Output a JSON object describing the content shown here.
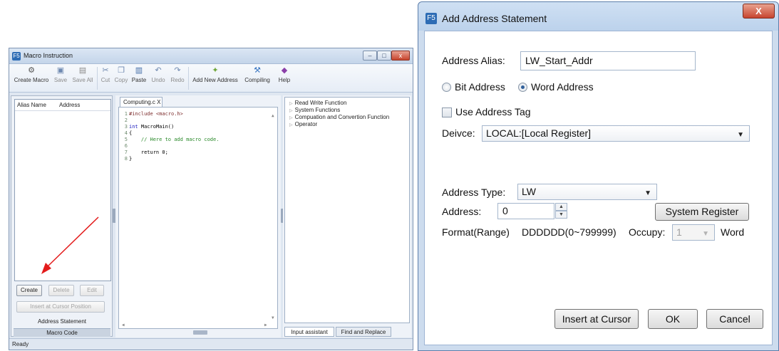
{
  "macro_window": {
    "title": "Macro Instruction",
    "ribbon": [
      {
        "label": "Create Macro",
        "icon": "create-macro-icon",
        "glyph": "⚙"
      },
      {
        "label": "Save",
        "icon": "save-icon",
        "glyph": "▣"
      },
      {
        "label": "Save All",
        "icon": "save-all-icon",
        "glyph": "▤"
      },
      {
        "label": "Cut",
        "icon": "cut-icon",
        "glyph": "✂"
      },
      {
        "label": "Copy",
        "icon": "copy-icon",
        "glyph": "❐"
      },
      {
        "label": "Paste",
        "icon": "paste-icon",
        "glyph": "▥"
      },
      {
        "label": "Undo",
        "icon": "undo-icon",
        "glyph": "↶"
      },
      {
        "label": "Redo",
        "icon": "redo-icon",
        "glyph": "↷"
      },
      {
        "label": "Add New Address",
        "icon": "add-address-icon",
        "glyph": "✦"
      },
      {
        "label": "Compiling",
        "icon": "compiling-icon",
        "glyph": "⚒"
      },
      {
        "label": "Help",
        "icon": "help-icon",
        "glyph": "◆"
      }
    ],
    "alias_columns": {
      "alias": "Alias Name",
      "address": "Address"
    },
    "buttons": {
      "create": "Create",
      "delete": "Delete",
      "edit": "Edit",
      "insert": "Insert at Cursor Position"
    },
    "panel_tabs": {
      "address_statement": "Address Statement",
      "macro_code": "Macro Code"
    },
    "editor_tab": "Computing.c  X",
    "code": {
      "l1_num": "1",
      "l1": "#include <macro.h>",
      "l2_num": "2",
      "l3_num": "3",
      "l3_kw": "int",
      "l3": " MacroMain()",
      "l4_num": "4",
      "l4": "{",
      "l5_num": "5",
      "l5": "    // Here to add macro code.",
      "l6_num": "6",
      "l7_num": "7",
      "l7": "    return 0;",
      "l8_num": "8",
      "l8": "}"
    },
    "assistant_items": [
      "Read Write Function",
      "System Functions",
      "Compuation and Convertion Function",
      "Operator"
    ],
    "bottom_tabs": {
      "input_assistant": "Input assistant",
      "find_replace": "Find and Replace"
    },
    "status": "Ready"
  },
  "dialog": {
    "title": "Add Address Statement",
    "alias_label": "Address Alias:",
    "alias_value": "LW_Start_Addr",
    "bit_address": "Bit Address",
    "word_address": "Word Address",
    "use_tag": "Use Address Tag",
    "device_label": "Deivce:",
    "device_value": "LOCAL:[Local Register]",
    "address_type_label": "Address Type:",
    "address_type_value": "LW",
    "address_label": "Address:",
    "address_value": "0",
    "system_register": "System Register",
    "format_label": "Format(Range)",
    "format_value": "DDDDDD(0~799999)",
    "occupy_label": "Occupy:",
    "occupy_value": "1",
    "word_label": "Word",
    "insert_at_cursor": "Insert at Cursor",
    "ok": "OK",
    "cancel": "Cancel",
    "close_glyph": "X"
  },
  "app_icon_text": "F5",
  "colors": {
    "accent": "#2d6cb5",
    "arrow": "#e31b1b"
  }
}
